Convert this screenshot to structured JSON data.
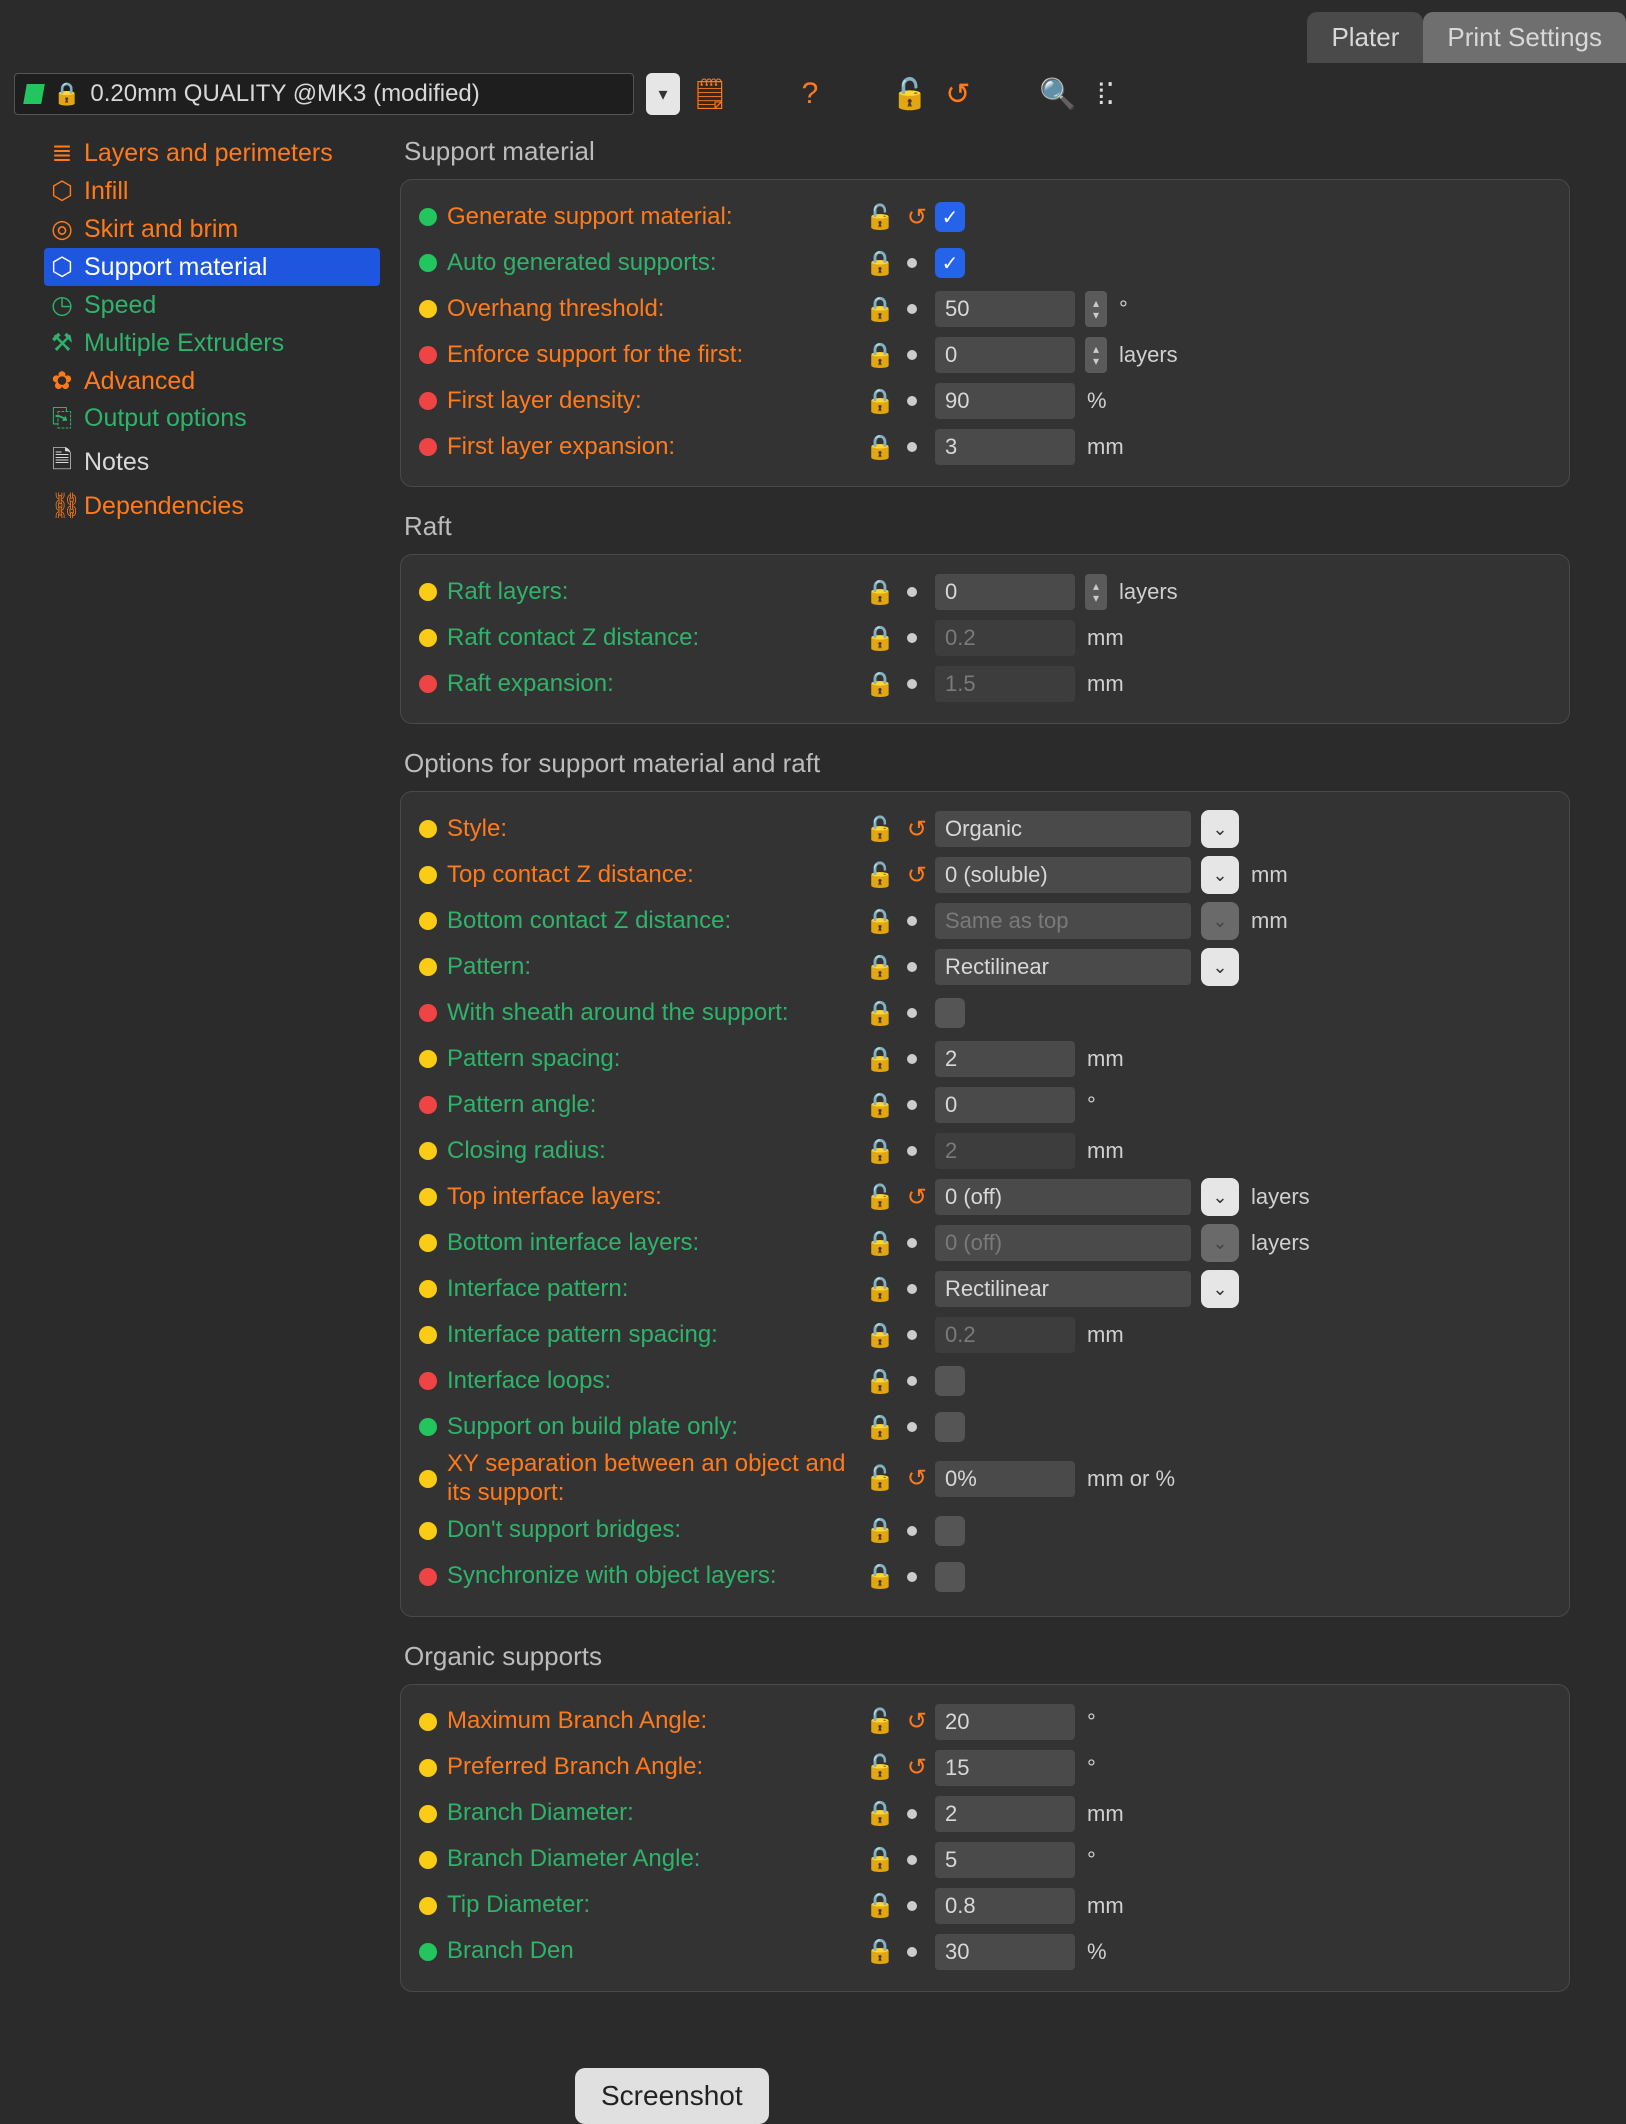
{
  "tabs": {
    "plater": "Plater",
    "print_settings": "Print Settings"
  },
  "preset": "0.20mm QUALITY @MK3 (modified)",
  "sidebar": [
    {
      "label": "Layers and perimeters",
      "icon": "≣",
      "color": "c-orange"
    },
    {
      "label": "Infill",
      "icon": "⬡",
      "color": "c-orange"
    },
    {
      "label": "Skirt and brim",
      "icon": "◎",
      "color": "c-orange"
    },
    {
      "label": "Support material",
      "icon": "⬡",
      "color": "",
      "selected": true
    },
    {
      "label": "Speed",
      "icon": "◷",
      "color": "c-green"
    },
    {
      "label": "Multiple Extruders",
      "icon": "⚒",
      "color": "c-green"
    },
    {
      "label": "Advanced",
      "icon": "✿",
      "color": "c-orange"
    },
    {
      "label": "Output options",
      "icon": "⎘",
      "color": "c-green"
    },
    {
      "label": "Notes",
      "icon": "🗎",
      "color": ""
    },
    {
      "label": "Dependencies",
      "icon": "⛓",
      "color": "c-orange"
    }
  ],
  "sections": {
    "support_material": "Support material",
    "raft": "Raft",
    "options": "Options for support material and raft",
    "organic": "Organic supports"
  },
  "rows": {
    "gen": {
      "label": "Generate support material:",
      "checked": true
    },
    "auto": {
      "label": "Auto generated supports:",
      "checked": true
    },
    "overhang": {
      "label": "Overhang threshold:",
      "value": "50",
      "unit": "°"
    },
    "enforce": {
      "label": "Enforce support for the first:",
      "value": "0",
      "unit": "layers"
    },
    "fld": {
      "label": "First layer density:",
      "value": "90",
      "unit": "%"
    },
    "fle": {
      "label": "First layer expansion:",
      "value": "3",
      "unit": "mm"
    },
    "raft_layers": {
      "label": "Raft layers:",
      "value": "0",
      "unit": "layers"
    },
    "raft_contact": {
      "label": "Raft contact Z distance:",
      "value": "0.2",
      "unit": "mm"
    },
    "raft_exp": {
      "label": "Raft expansion:",
      "value": "1.5",
      "unit": "mm"
    },
    "style": {
      "label": "Style:",
      "value": "Organic"
    },
    "top_z": {
      "label": "Top contact Z distance:",
      "value": "0 (soluble)",
      "unit": "mm"
    },
    "bot_z": {
      "label": "Bottom contact Z distance:",
      "value": "Same as top",
      "unit": "mm"
    },
    "pattern": {
      "label": "Pattern:",
      "value": "Rectilinear"
    },
    "sheath": {
      "label": "With sheath around the support:"
    },
    "pat_spacing": {
      "label": "Pattern spacing:",
      "value": "2",
      "unit": "mm"
    },
    "pat_angle": {
      "label": "Pattern angle:",
      "value": "0",
      "unit": "°"
    },
    "closing": {
      "label": "Closing radius:",
      "value": "2",
      "unit": "mm"
    },
    "top_if": {
      "label": "Top interface layers:",
      "value": "0 (off)",
      "unit": "layers"
    },
    "bot_if": {
      "label": "Bottom interface layers:",
      "value": "0 (off)",
      "unit": "layers"
    },
    "if_pattern": {
      "label": "Interface pattern:",
      "value": "Rectilinear"
    },
    "if_spacing": {
      "label": "Interface pattern spacing:",
      "value": "0.2",
      "unit": "mm"
    },
    "if_loops": {
      "label": "Interface loops:"
    },
    "bp_only": {
      "label": "Support on build plate only:"
    },
    "xy_sep": {
      "label": "XY separation between an object and its support:",
      "value": "0%",
      "unit": "mm or %"
    },
    "no_bridge": {
      "label": "Don't support bridges:"
    },
    "sync": {
      "label": "Synchronize with object layers:"
    },
    "max_branch": {
      "label": "Maximum Branch Angle:",
      "value": "20",
      "unit": "°"
    },
    "pref_branch": {
      "label": "Preferred Branch Angle:",
      "value": "15",
      "unit": "°"
    },
    "branch_dia": {
      "label": "Branch Diameter:",
      "value": "2",
      "unit": "mm"
    },
    "branch_dia_ang": {
      "label": "Branch Diameter Angle:",
      "value": "5",
      "unit": "°"
    },
    "tip_dia": {
      "label": "Tip Diameter:",
      "value": "0.8",
      "unit": "mm"
    },
    "branch_den": {
      "label": "Branch Den",
      "value": "30",
      "unit": "%"
    }
  },
  "tooltip": "Screenshot"
}
